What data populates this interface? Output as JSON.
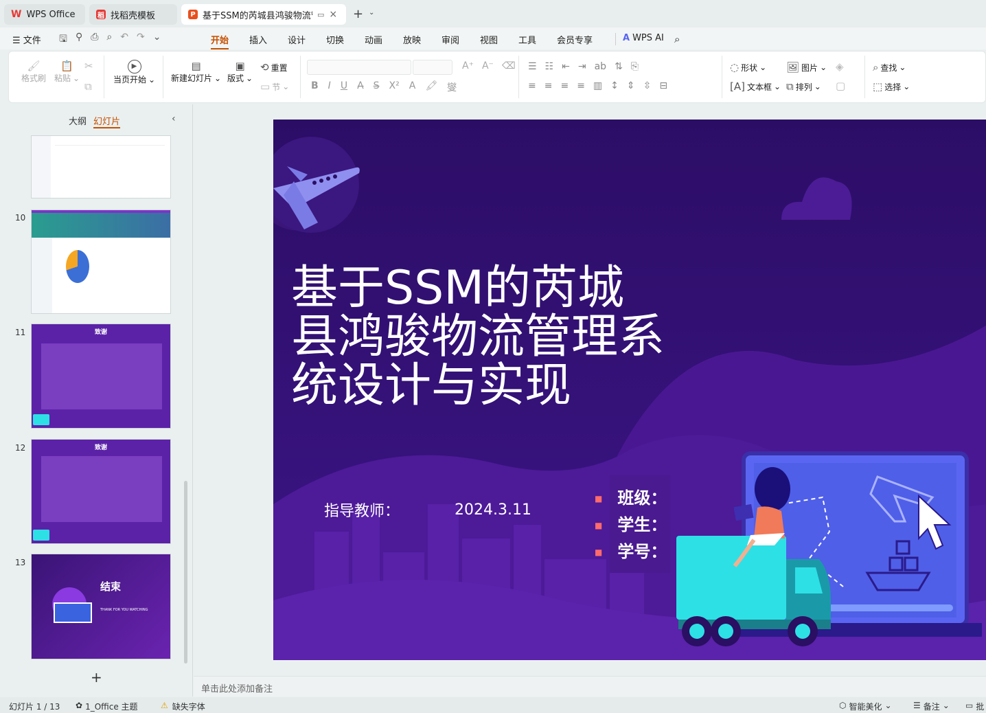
{
  "tabs": [
    {
      "label": "WPS Office",
      "icon": "wps-logo-icon"
    },
    {
      "label": "找稻壳模板",
      "icon": "docer-icon"
    },
    {
      "label": "基于SSM的芮城县鸿骏物流管",
      "icon": "ppt-icon"
    }
  ],
  "menu": {
    "file": "文件",
    "items": [
      "开始",
      "插入",
      "设计",
      "切换",
      "动画",
      "放映",
      "审阅",
      "视图",
      "工具",
      "会员专享"
    ],
    "active": "开始",
    "wps_ai": "WPS AI"
  },
  "ribbon": {
    "format_painter": "格式刷",
    "paste": "粘贴",
    "play_from_current": "当页开始",
    "new_slide": "新建幻灯片",
    "layout": "版式",
    "reset": "重置",
    "section": "节",
    "shape": "形状",
    "picture": "图片",
    "find": "查找",
    "textbox": "文本框",
    "arrange": "排列",
    "select": "选择"
  },
  "left_panel": {
    "tab_outline": "大纲",
    "tab_slides": "幻灯片",
    "slide_numbers": [
      "10",
      "11",
      "12",
      "13"
    ],
    "thumb_thanks_title": "致谢",
    "thumb_end_title": "结束",
    "thumb_end_sub": "THANK FOR YOU WATCHING",
    "add_label": "+"
  },
  "slide": {
    "title_lines": [
      "基于SSM的芮城",
      "县鸿骏物流管理系",
      "统设计与实现"
    ],
    "advisor_label": "指导教师：",
    "date": "2024.3.11",
    "fields": [
      "班级：",
      "学生：",
      "学号："
    ]
  },
  "notes_placeholder": "单击此处添加备注",
  "status": {
    "slide_counter": "幻灯片 1 / 13",
    "theme": "1_Office 主题",
    "missing_font": "缺失字体",
    "smart_beautify": "智能美化",
    "notes": "备注",
    "comment": "批"
  },
  "colors": {
    "accent": "#c65000",
    "slide_bg": "#2a0f63",
    "truck": "#2de0e6"
  }
}
